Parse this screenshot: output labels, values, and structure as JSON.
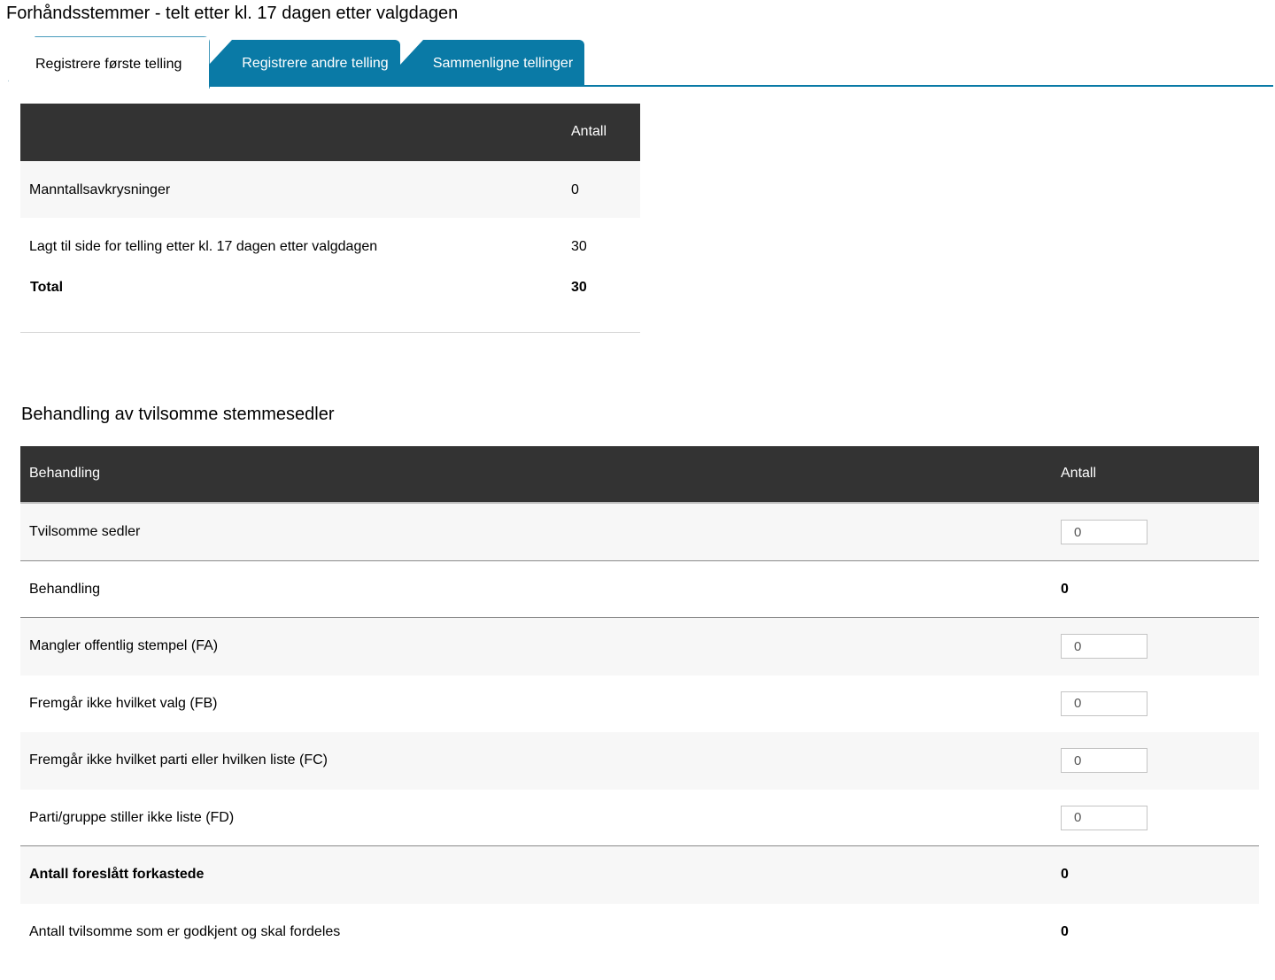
{
  "page": {
    "title": "Forhåndsstemmer - telt etter kl. 17 dagen etter valgdagen"
  },
  "tabs": [
    {
      "label": "Registrere første telling",
      "active": true
    },
    {
      "label": "Registrere andre telling",
      "active": false
    },
    {
      "label": "Sammenligne tellinger",
      "active": false
    }
  ],
  "colors": {
    "tab_blue": "#0a7aa6",
    "table_header": "#333333",
    "row_shade": "#f7f7f7"
  },
  "summary_table": {
    "header_antall": "Antall",
    "rows": [
      {
        "label": "Manntallsavkrysninger",
        "value": "0"
      },
      {
        "label": "Lagt til side for telling etter kl. 17 dagen etter valgdagen",
        "value": "30"
      }
    ],
    "total": {
      "label": "Total",
      "value": "30"
    }
  },
  "doubtful_section": {
    "title": "Behandling av tvilsomme stemmesedler",
    "header_behandling": "Behandling",
    "header_antall": "Antall",
    "rows": [
      {
        "label": "Tvilsomme sedler",
        "input_value": "0"
      },
      {
        "label": "Behandling",
        "value": "0"
      },
      {
        "label": "Mangler offentlig stempel (FA)",
        "input_value": "0"
      },
      {
        "label": "Fremgår ikke hvilket valg (FB)",
        "input_value": "0"
      },
      {
        "label": "Fremgår ikke hvilket parti eller hvilken liste (FC)",
        "input_value": "0"
      },
      {
        "label": "Parti/gruppe stiller ikke liste (FD)",
        "input_value": "0"
      },
      {
        "label": "Antall foreslått forkastede",
        "value": "0"
      },
      {
        "label": "Antall tvilsomme som er godkjent og skal fordeles",
        "value": "0"
      }
    ]
  }
}
